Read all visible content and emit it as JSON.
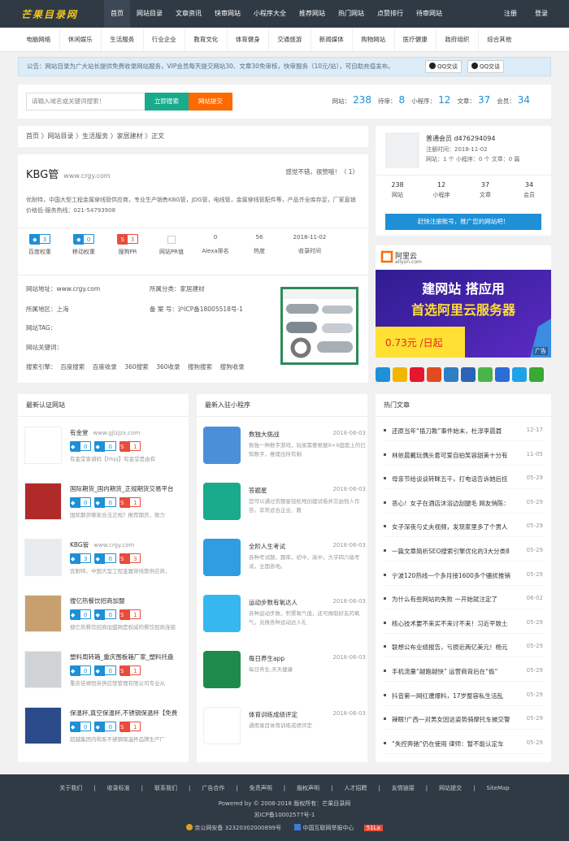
{
  "header": {
    "logo": "芒果目录网",
    "nav": [
      "首页",
      "网站目录",
      "文章资讯",
      "快审网站",
      "小程序大全",
      "推荐网站",
      "热门网站",
      "点赞排行",
      "待审网站"
    ],
    "login": "注册",
    "register": "登录"
  },
  "categories": [
    "电脑网络",
    "休闲娱乐",
    "生活服务",
    "行业企业",
    "教育文化",
    "体育健身",
    "交通旅游",
    "新闻媒体",
    "购物网站",
    "医疗健康",
    "政府组织",
    "综合其他"
  ],
  "notice": {
    "text": "公告：网站目录为广大站长提供免费收录网站服务，VIP会员每天提交网站30、文章30免审核，快审服务（10元/站），可自助充值发布。",
    "qq1": "QQ交谈",
    "qq2": "QQ交谈"
  },
  "search": {
    "placeholder": "请输入域名或关键词搜索！",
    "search_btn": "立即搜索",
    "submit_btn": "网站提交"
  },
  "stats": {
    "l1": "网站：",
    "v1": "238",
    "l2": "待审：",
    "v2": "8",
    "l3": "小程序：",
    "v3": "12",
    "l4": "文章：",
    "v4": "37",
    "l5": "会员：",
    "v5": "34"
  },
  "breadcrumb": "首页 〉网站目录 〉生活服务 〉家居建材 〉正文",
  "site": {
    "name": "KBG管",
    "url": "www.crgy.com",
    "votes": "感觉不错，很赞哦！（ 1）",
    "desc": "优耐特，中国大型工程金属穿线管供应商，专业生产销售KBG管，JDG管，电线管，金属穿线管配件等，产品齐全库存足，厂家直销价格低-服务热线：021-54793908",
    "baidu": "3",
    "mobile": "0",
    "pr": "3",
    "baidu_lbl": "百度权重",
    "mobile_lbl": "移动权重",
    "pr_lbl": "搜狗PR",
    "snapshot_lbl": "网站PR值",
    "alexa": "0",
    "alexa_lbl": "Alexa排名",
    "hot": "56",
    "hot_lbl": "热度",
    "date": "2018-11-02",
    "date_lbl": "收录时间",
    "addr": "网站地址：www.crgy.com",
    "cat": "所属分类：家居建材",
    "region": "所属地区：上海",
    "icp": "备 案 号：沪ICP备18005518号-1",
    "tag": "网站TAG：",
    "kw": "网站关键词：",
    "engines": "搜索引擎：  百度搜索    百度收录    360搜索    360收录    搜狗搜索    搜狗收录"
  },
  "user": {
    "name": "普通会员  d476294094",
    "reg": "注册时间：2018-11-02",
    "counts": "网站：1 个  小程序：0 个  文章：0 篇",
    "stats": [
      {
        "v": "238",
        "l": "网站"
      },
      {
        "v": "12",
        "l": "小程序"
      },
      {
        "v": "37",
        "l": "文章"
      },
      {
        "v": "34",
        "l": "会员"
      }
    ],
    "reg_btn": "赶快注册账号，推广您的网站吧！"
  },
  "ad": {
    "brand": "阿里云",
    "domain": "aliyun.com",
    "line1": "建网站 搭应用",
    "line2": "首选阿里云服务器",
    "price": "0.73元 /日起",
    "tag": "广告"
  },
  "recent": {
    "title": "最新认证网站",
    "items": [
      {
        "name": "有金堂",
        "url": "www.gjlzjzx.com",
        "b1": "0",
        "b2": "0",
        "b3": "1",
        "desc": "有金堂害调码【hhpj】有金堂是由有"
      },
      {
        "name": "国际期货_国内期货_正规期货交易平台",
        "url": "",
        "b1": "0",
        "b2": "0",
        "b3": "1",
        "desc": "国际期货哪家合法正规？推荐期货，致力"
      },
      {
        "name": "KBG管",
        "url": "www.crgy.com",
        "b1": "3",
        "b2": "0",
        "b3": "3",
        "desc": "优耐特，中国大型工程金属穿线管供应商，"
      },
      {
        "name": "搜亿热餐饮招商加盟",
        "url": "",
        "b1": "0",
        "b2": "0",
        "b3": "1",
        "desc": "搜亿热餐饮招商加盟网是权威的餐饮招商连锁"
      },
      {
        "name": "塑料周转箱_重庆围板箱厂家_塑料托盘",
        "url": "",
        "b1": "0",
        "b2": "0",
        "b3": "1",
        "desc": "重庆佳顺恒央供应塑管理有限公司专业从"
      },
      {
        "name": "保温杯,真空保温杯,不锈钢保温杯【免费",
        "url": "",
        "b1": "0",
        "b2": "0",
        "b3": "1",
        "desc": "超越集团内和系不锈钢保温杯品牌生产厂"
      }
    ]
  },
  "mini": {
    "title": "最新入驻小程序",
    "items": [
      {
        "name": "数独大挑战",
        "date": "2018-06-03",
        "desc": "数独一种数字游戏，玩家需要根据9×9盘面上的已知数字，推理出所有剩"
      },
      {
        "name": "答题星",
        "date": "2018-06-03",
        "desc": "您可以通过答题星轻松地创建试卷并交由他人作答，非常适合企业、教"
      },
      {
        "name": "全阶人生考试",
        "date": "2018-06-03",
        "desc": "各种考试题，题库，初中，高中，大学四六级考试，全国各地。"
      },
      {
        "name": "运动步数有氧达人",
        "date": "2018-06-03",
        "desc": "各种运动步数，积累氧气值，还可做取好友的氧气，兑换各种运动达人礼"
      },
      {
        "name": "每日养生app",
        "date": "2018-06-03",
        "desc": "每日养生,天天健康"
      },
      {
        "name": "体育训练成绩评定",
        "date": "2018-06-03",
        "desc": "通用录目体育训练成绩评定"
      }
    ]
  },
  "hot": {
    "title": "热门文章",
    "items": [
      {
        "t": "还原当年“插刀教”事件始末，杜淳李晨聂",
        "d": "12-17"
      },
      {
        "t": "林依晨戴玩偶头套可爱自拍笑容甜美十分有",
        "d": "11-05"
      },
      {
        "t": "母亲节给谈谈转眯五千，打电话告诉她后挂",
        "d": "05-29"
      },
      {
        "t": "恶心！女子在酒店沐浴边刮腿毛 网友悄陈：",
        "d": "05-29"
      },
      {
        "t": "女子深夜与丈夫视频，发现家里多了个男人",
        "d": "05-29"
      },
      {
        "t": "一篇文章简析SEO搜索引擎优化的3大分类8",
        "d": "05-29"
      },
      {
        "t": "宁波120热线一个多月接1600多个骚扰推销",
        "d": "05-29"
      },
      {
        "t": "为什么有些网站的失败 一开始就注定了",
        "d": "06-02"
      },
      {
        "t": "核心技术要不来买不来讨不来！习近平致土",
        "d": "05-29"
      },
      {
        "t": "联想公布业绩报告，亏损近两亿美元！杨元",
        "d": "05-29"
      },
      {
        "t": "手机流量“越跑越快” 运营商背后在“偷”",
        "d": "05-29"
      },
      {
        "t": "抖音第一网红遭爆料，17岁整容私生活乱",
        "d": "05-29"
      },
      {
        "t": "辣眼!广西一对男女因这姿势骑摩托车被交警",
        "d": "05-29"
      },
      {
        "t": "“失控奔驰”仍在使用 律师：暂不能认定车",
        "d": "05-29"
      }
    ]
  },
  "footer": {
    "links": [
      "关于我们",
      "收录标准",
      "联系我们",
      "广告合作",
      "免责声明",
      "版权声明",
      "人才招聘",
      "友情链接",
      "网站提交",
      "SiteMap"
    ],
    "powered": "Powered by © 2008-2018  版权所有：芒果目录网",
    "icp": "苏ICP备10002577号-1",
    "police": "京公网安备 32320302000899号",
    "report": "中国互联网举报中心",
    "la": "51La"
  },
  "colors": {
    "topbar": "#2f3a45",
    "accent": "#1e90d6",
    "green": "#1aaa8c",
    "orange": "#ff6a00"
  }
}
